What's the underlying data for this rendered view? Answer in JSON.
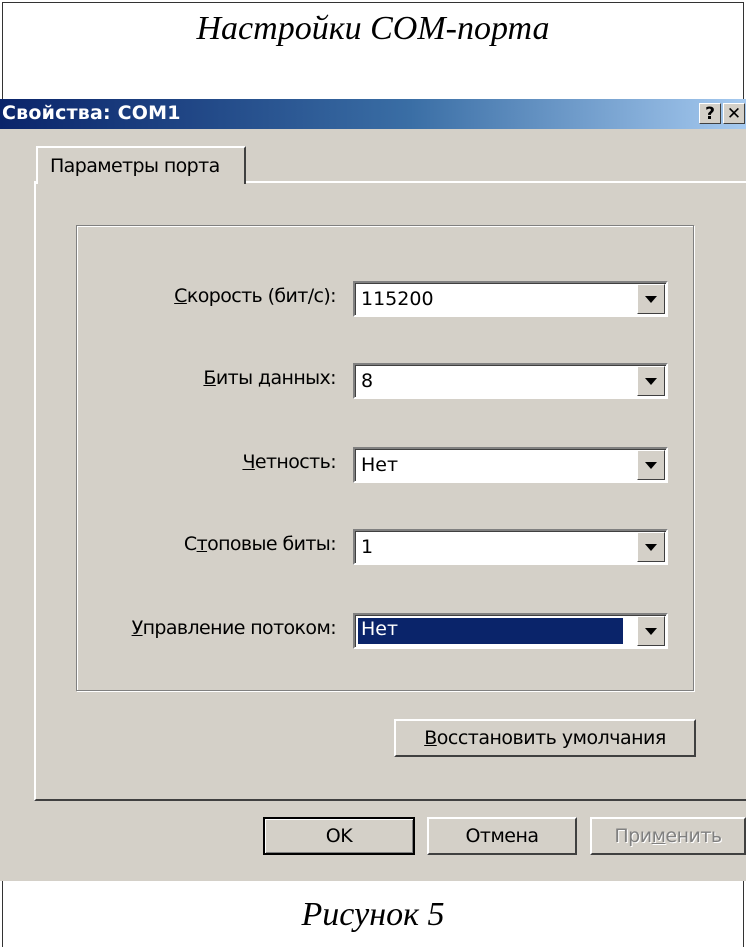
{
  "document": {
    "caption_top": "Настройки COM-порта",
    "caption_bottom": "Рисунок 5"
  },
  "window": {
    "title": "Свойства: COM1",
    "help_glyph": "?",
    "close_glyph": "✕"
  },
  "tabs": [
    {
      "label": "Параметры порта",
      "active": true
    }
  ],
  "fields": [
    {
      "label": "Скорость (бит/с):",
      "accel": "С",
      "value": "115200"
    },
    {
      "label": "Биты данных:",
      "accel": "Б",
      "value": "8"
    },
    {
      "label": "Четность:",
      "accel": "Ч",
      "value": "Нет"
    },
    {
      "label": "Стоповые биты:",
      "accel": "т",
      "value": "1"
    },
    {
      "label": "Управление потоком:",
      "accel": "У",
      "value": "Нет",
      "focused": true
    }
  ],
  "buttons": {
    "restore_defaults": "Восстановить умолчания",
    "ok": "OK",
    "cancel": "Отмена",
    "apply": "Применить"
  },
  "colors": {
    "face": "#d4d0c8",
    "title_start": "#0a246a",
    "title_end": "#a6caf0",
    "selection": "#0a246a"
  }
}
